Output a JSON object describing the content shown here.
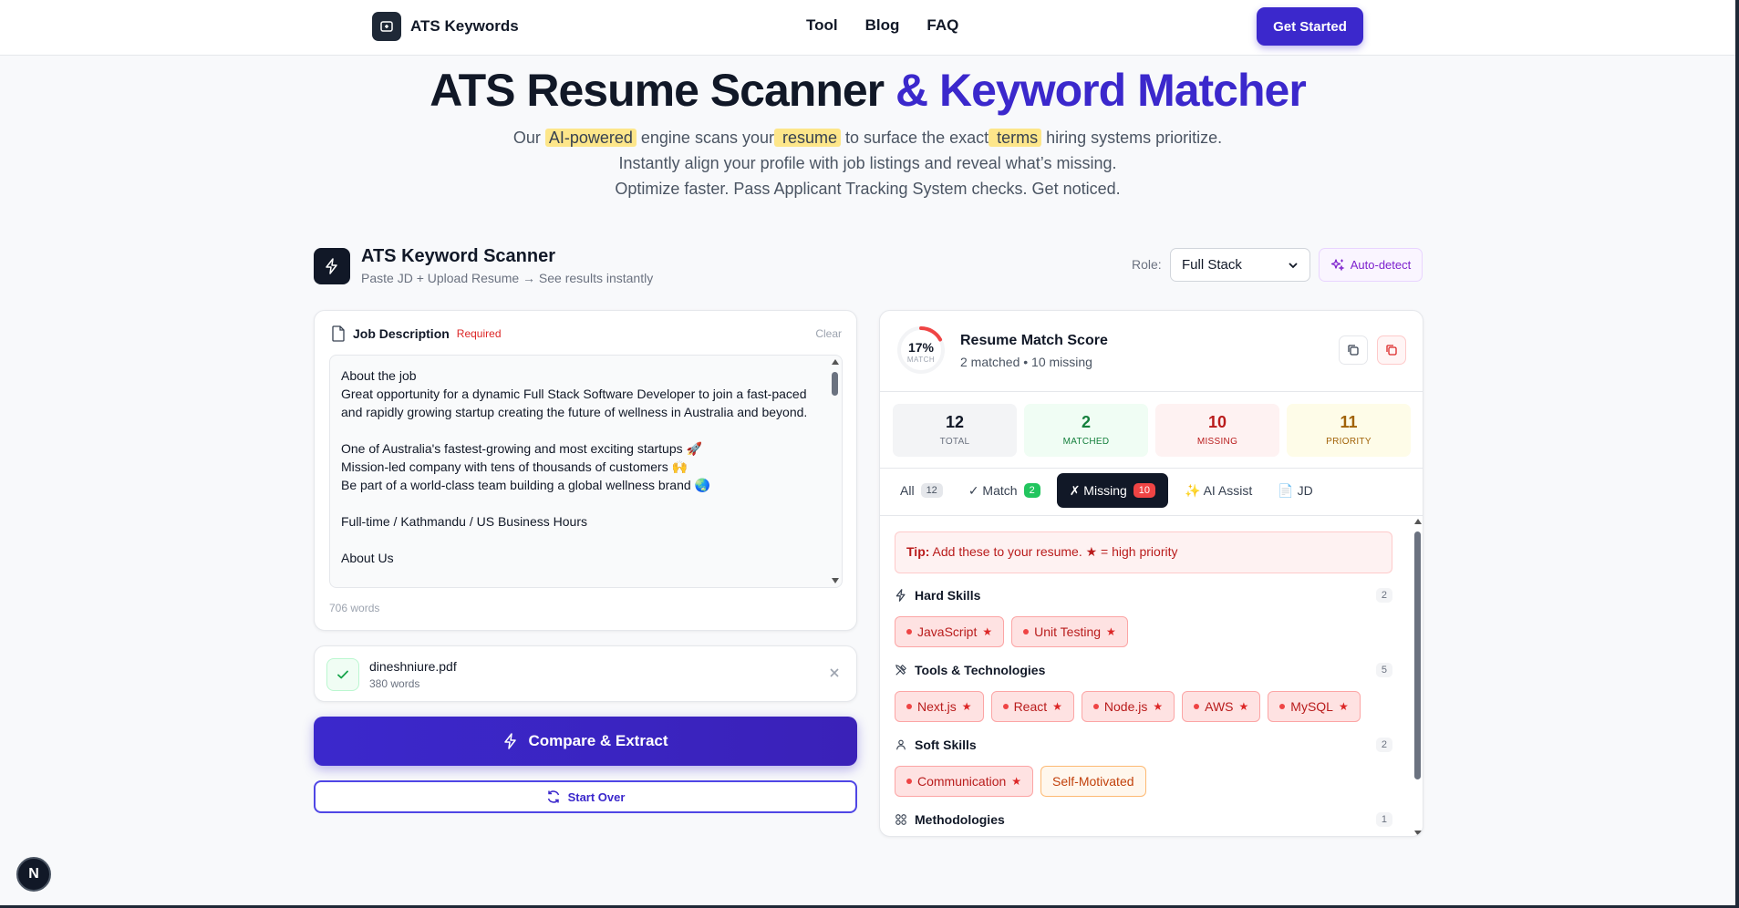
{
  "nav": {
    "brand": "ATS Keywords",
    "links": [
      "Tool",
      "Blog",
      "FAQ"
    ],
    "cta": "Get Started"
  },
  "hero": {
    "title_part1": "ATS Resume Scanner",
    "title_part2": " & Keyword Matcher",
    "line1_a": "Our ",
    "line1_hl1": "AI-powered",
    "line1_b": " engine scans your",
    "line1_hl2": " resume",
    "line1_c": " to surface the exact",
    "line1_hl3": " terms",
    "line1_d": " hiring systems prioritize.",
    "line2": "Instantly align your profile with job listings and reveal what’s missing.",
    "line3": "Optimize faster. Pass Applicant Tracking System checks. Get noticed."
  },
  "scanner": {
    "title": "ATS Keyword Scanner",
    "subtitle": "Paste JD + Upload Resume → See results instantly",
    "role_label": "Role:",
    "role_value": "Full Stack",
    "auto_detect": "Auto-detect"
  },
  "jd": {
    "title": "Job Description",
    "required": "Required",
    "clear": "Clear",
    "text": "About the job\nGreat opportunity for a dynamic Full Stack Software Developer to join a fast-paced and rapidly growing startup creating the future of wellness in Australia and beyond.\n\nOne of Australia's fastest-growing and most exciting startups 🚀\nMission-led company with tens of thousands of customers 🙌\nBe part of a world-class team building a global wellness brand 🌏\n\nFull-time / Kathmandu / US Business Hours\n\nAbout Us",
    "word_count": "706 words"
  },
  "file": {
    "name": "dineshniure.pdf",
    "words": "380 words"
  },
  "actions": {
    "compare": "Compare & Extract",
    "start_over": "Start Over"
  },
  "score": {
    "percent": "17%",
    "percent_value": 17,
    "ring_label": "MATCH",
    "title": "Resume Match Score",
    "detail": "2 matched • 10 missing",
    "stats": [
      {
        "num": "12",
        "label": "TOTAL"
      },
      {
        "num": "2",
        "label": "MATCHED"
      },
      {
        "num": "10",
        "label": "MISSING"
      },
      {
        "num": "11",
        "label": "PRIORITY"
      }
    ]
  },
  "tabs": [
    {
      "label": "All",
      "count": "12"
    },
    {
      "label": "✓ Match",
      "count": "2"
    },
    {
      "label": "✗ Missing",
      "count": "10"
    },
    {
      "label": "✨ AI Assist",
      "count": ""
    },
    {
      "label": "📄 JD",
      "count": ""
    }
  ],
  "tip": {
    "prefix": "Tip:",
    "text": " Add these to your resume. ★ = high priority"
  },
  "sections": [
    {
      "title": "Hard Skills",
      "count": "2",
      "chips": [
        "JavaScript",
        "Unit Testing"
      ]
    },
    {
      "title": "Tools & Technologies",
      "count": "5",
      "chips": [
        "Next.js",
        "React",
        "Node.js",
        "AWS",
        "MySQL"
      ]
    },
    {
      "title": "Soft Skills",
      "count": "2",
      "chips": [
        "Communication",
        "Self-Motivated"
      ]
    },
    {
      "title": "Methodologies",
      "count": "1",
      "chips": []
    }
  ],
  "star": "★",
  "footer_badge": "N",
  "colors": {
    "accent": "#3b28cc",
    "dark": "#111827",
    "missing": "#b91c1c",
    "matched": "#15803d",
    "priority": "#a16207"
  }
}
